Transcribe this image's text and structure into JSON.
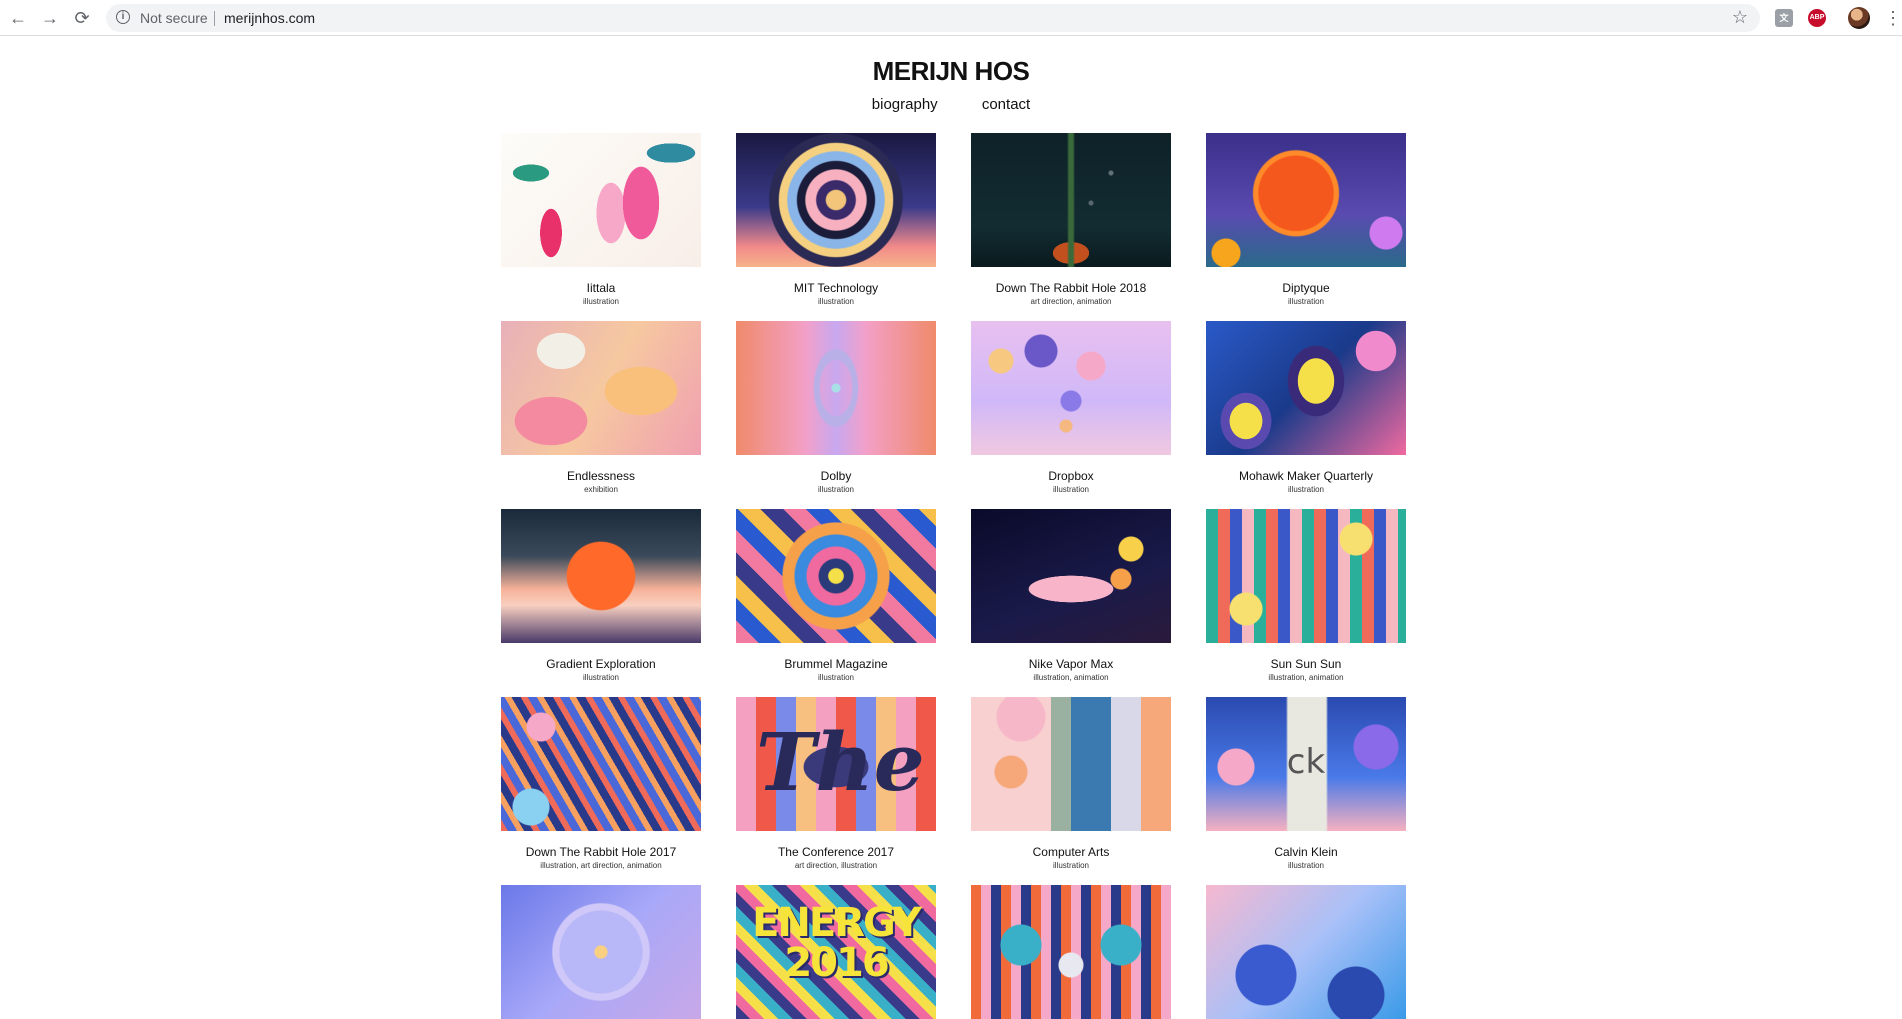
{
  "browser": {
    "back_glyph": "←",
    "forward_glyph": "→",
    "reload_glyph": "⟳",
    "security_label": "Not secure",
    "url": "merijnhos.com",
    "star_glyph": "☆",
    "ext_translate_label": "文",
    "ext_abp_label": "ABP",
    "menu_glyph": "⋮"
  },
  "site": {
    "title": "MERIJN HOS",
    "nav": [
      "biography",
      "contact"
    ]
  },
  "projects": [
    {
      "title": "Iittala",
      "tags": "illustration"
    },
    {
      "title": "MIT Technology",
      "tags": "illustration"
    },
    {
      "title": "Down The Rabbit Hole 2018",
      "tags": "art direction, animation"
    },
    {
      "title": "Diptyque",
      "tags": "illustration"
    },
    {
      "title": "Endlessness",
      "tags": "exhibition"
    },
    {
      "title": "Dolby",
      "tags": "illustration"
    },
    {
      "title": "Dropbox",
      "tags": "illustration"
    },
    {
      "title": "Mohawk Maker Quarterly",
      "tags": "illustration"
    },
    {
      "title": "Gradient Exploration",
      "tags": "illustration"
    },
    {
      "title": "Brummel Magazine",
      "tags": "illustration"
    },
    {
      "title": "Nike Vapor Max",
      "tags": "illustration, animation"
    },
    {
      "title": "Sun Sun Sun",
      "tags": "illustration, animation"
    },
    {
      "title": "Down The Rabbit Hole 2017",
      "tags": "illustration, art direction, animation"
    },
    {
      "title": "The Conference 2017",
      "tags": "art direction, illustration"
    },
    {
      "title": "Computer Arts",
      "tags": "illustration"
    },
    {
      "title": "Calvin Klein",
      "tags": "illustration"
    },
    {
      "title": "",
      "tags": ""
    },
    {
      "title": "",
      "tags": ""
    },
    {
      "title": "",
      "tags": ""
    },
    {
      "title": "",
      "tags": ""
    }
  ],
  "artwork_text": {
    "energy": "ENERGY 2016",
    "ck": "ck",
    "the": "The"
  }
}
